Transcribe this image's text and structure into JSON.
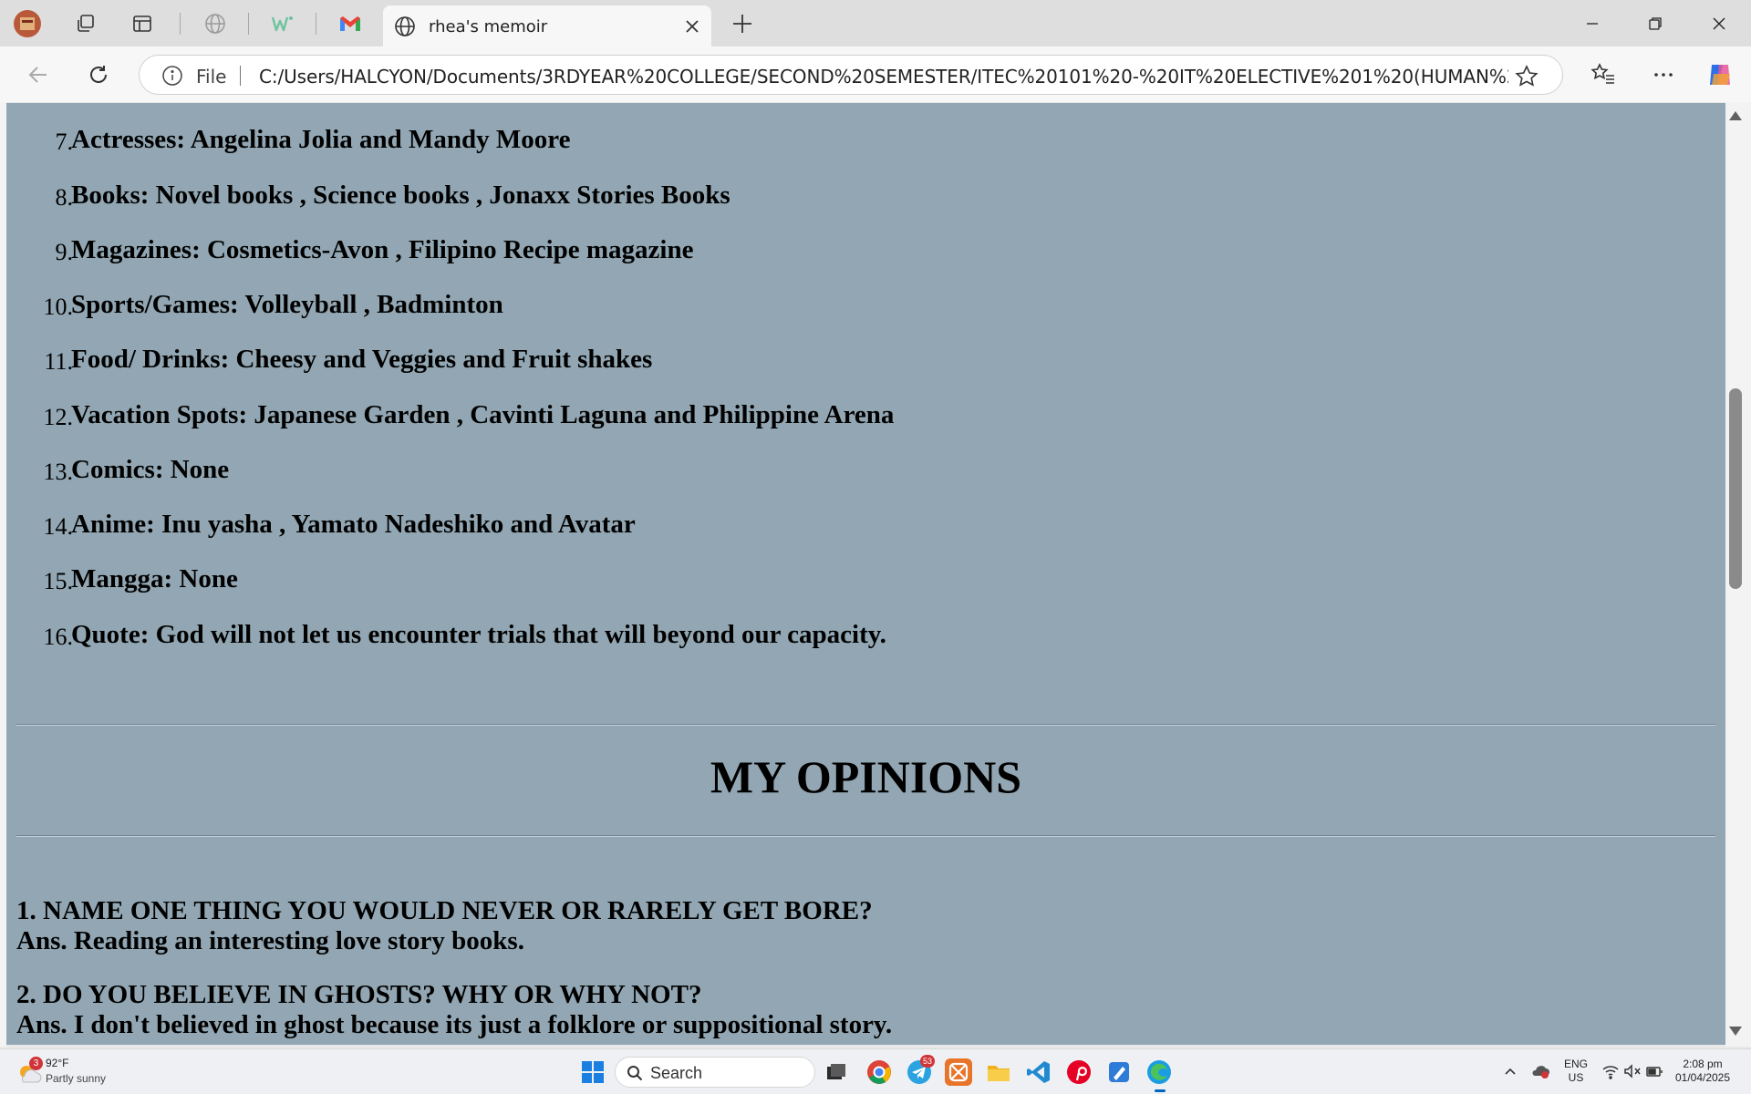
{
  "browser": {
    "tab_title": "rhea's memoir",
    "address_prefix": "File",
    "url": "C:/Users/HALCYON/Documents/3RDYEAR%20COLLEGE/SECOND%20SEMESTER/ITEC%20101%20-%20IT%20ELECTIVE%201%20(HUMAN%20CO..."
  },
  "favorites_list": [
    {
      "num": "7.",
      "text": "Actresses: Angelina Jolia and Mandy Moore"
    },
    {
      "num": "8.",
      "text": "Books: Novel books , Science books , Jonaxx Stories Books"
    },
    {
      "num": "9.",
      "text": "Magazines: Cosmetics-Avon , Filipino Recipe magazine"
    },
    {
      "num": "10.",
      "text": "Sports/Games: Volleyball , Badminton"
    },
    {
      "num": "11.",
      "text": "Food/ Drinks: Cheesy and Veggies and Fruit shakes"
    },
    {
      "num": "12.",
      "text": "Vacation Spots: Japanese Garden , Cavinti Laguna and Philippine Arena"
    },
    {
      "num": "13.",
      "text": "Comics: None"
    },
    {
      "num": "14.",
      "text": "Anime: Inu yasha , Yamato Nadeshiko and Avatar"
    },
    {
      "num": "15.",
      "text": "Mangga: None"
    },
    {
      "num": "16.",
      "text": "Quote: God will not let us encounter trials that will beyond our capacity."
    }
  ],
  "opinions": {
    "heading": "MY OPINIONS",
    "items": [
      {
        "question": "1. NAME ONE THING YOU WOULD NEVER OR RARELY GET BORE?",
        "answer": "Ans. Reading an interesting love story books."
      },
      {
        "question": "2. DO YOU BELIEVE IN GHOSTS? WHY OR WHY NOT?",
        "answer": "Ans. I don't believed in ghost because its just a folklore or suppositional story."
      }
    ]
  },
  "taskbar": {
    "weather_badge": "3",
    "weather_temp": "92°F",
    "weather_desc": "Partly sunny",
    "search_label": "Search",
    "lang_top": "ENG",
    "lang_bottom": "US",
    "time": "2:08 pm",
    "date": "01/04/2025",
    "telegram_badge": "53"
  },
  "colors": {
    "page_background": "#92a7b3",
    "accent": "#0067c0"
  }
}
